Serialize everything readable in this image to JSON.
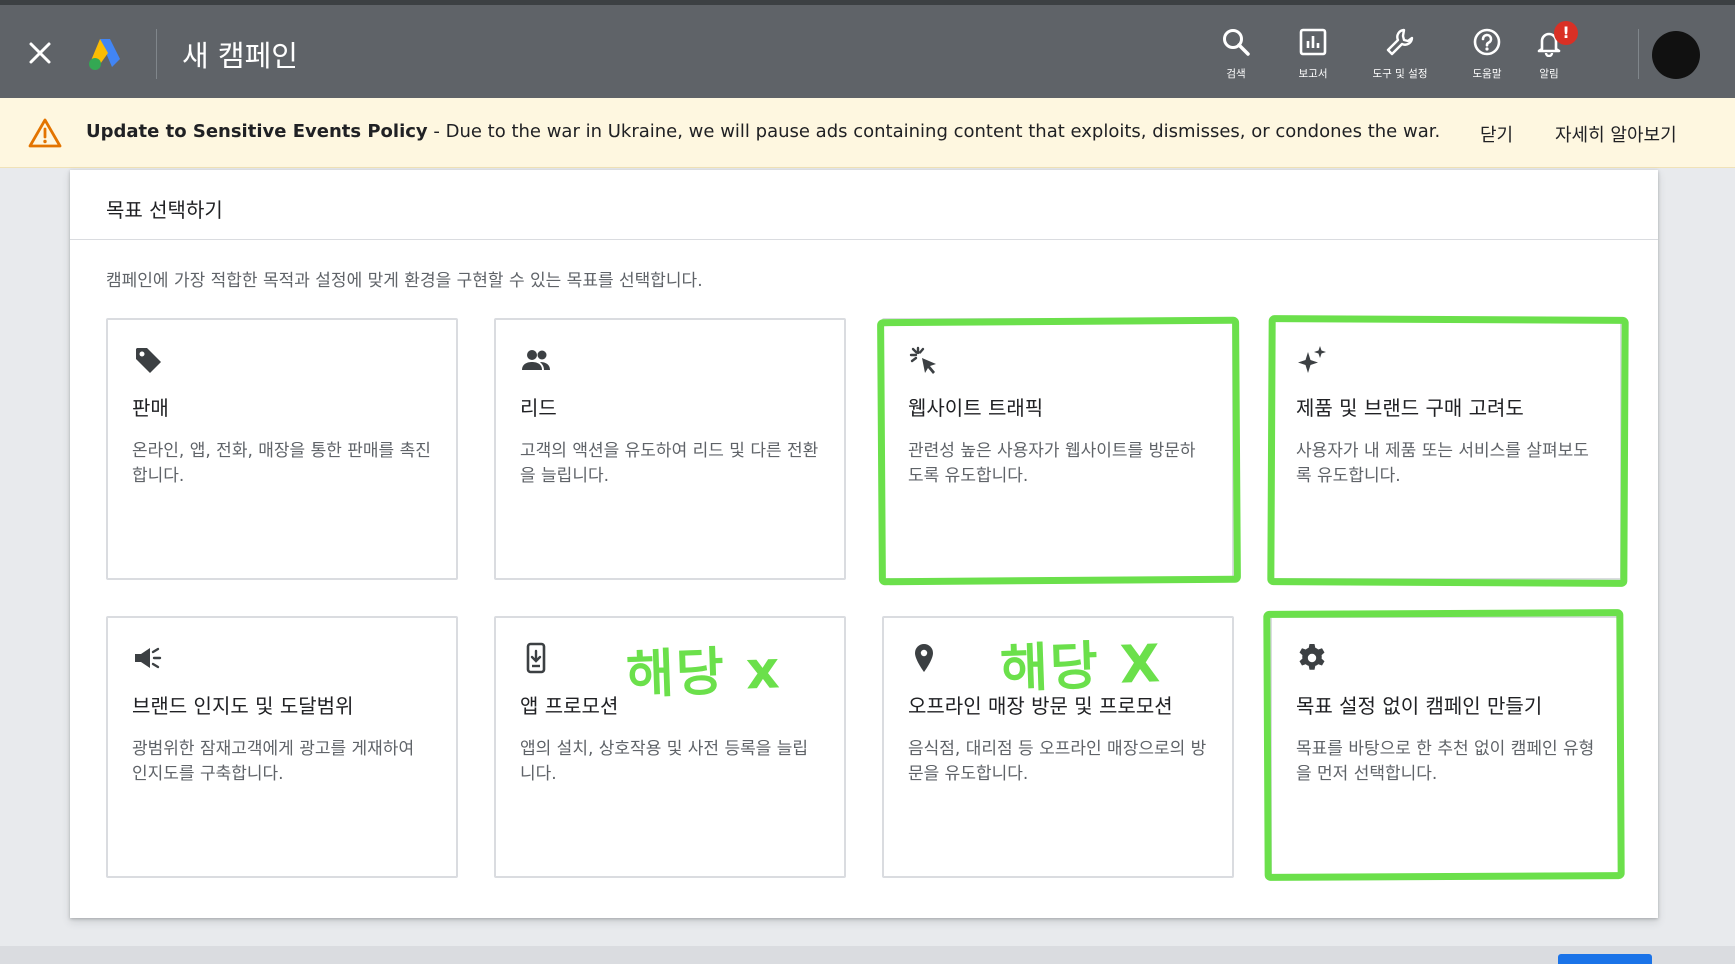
{
  "topbar": {
    "title": "새 캠페인",
    "tools": [
      {
        "label": "검색",
        "icon": "search-icon"
      },
      {
        "label": "보고서",
        "icon": "reports-icon"
      },
      {
        "label": "도구 및 설정",
        "icon": "tools-icon"
      },
      {
        "label": "도움말",
        "icon": "help-icon"
      },
      {
        "label": "알림",
        "icon": "notifications-icon",
        "badge": "!"
      }
    ]
  },
  "banner": {
    "title": "Update to Sensitive Events Policy",
    "separator": " - ",
    "message": "Due to the war in Ukraine, we will pause ads containing content that exploits, dismisses, or condones the war.",
    "dismiss_label": "닫기",
    "learn_more_label": "자세히 알아보기"
  },
  "panel": {
    "header": "목표 선택하기",
    "description": "캠페인에 가장 적합한 목적과 설정에 맞게 환경을 구현할 수 있는 목표를 선택합니다.",
    "goals": [
      {
        "title": "판매",
        "desc": "온라인, 앱, 전화, 매장을 통한 판매를 촉진합니다.",
        "icon": "tag-icon"
      },
      {
        "title": "리드",
        "desc": "고객의 액션을 유도하여 리드 및 다른 전환을 늘립니다.",
        "icon": "people-icon"
      },
      {
        "title": "웹사이트 트래픽",
        "desc": "관련성 높은 사용자가 웹사이트를 방문하도록 유도합니다.",
        "icon": "cursor-click-icon"
      },
      {
        "title": "제품 및 브랜드 구매 고려도",
        "desc": "사용자가 내 제품 또는 서비스를 살펴보도록 유도합니다.",
        "icon": "sparkle-icon"
      },
      {
        "title": "브랜드 인지도 및 도달범위",
        "desc": "광범위한 잠재고객에게 광고를 게재하여 인지도를 구축합니다.",
        "icon": "megaphone-icon"
      },
      {
        "title": "앱 프로모션",
        "desc": "앱의 설치, 상호작용 및 사전 등록을 늘립니다.",
        "icon": "phone-download-icon"
      },
      {
        "title": "오프라인 매장 방문 및 프로모션",
        "desc": "음식점, 대리점 등 오프라인 매장으로의 방문을 유도합니다.",
        "icon": "location-pin-icon"
      },
      {
        "title": "목표 설정 없이 캠페인 만들기",
        "desc": "목표를 바탕으로 한 추천 없이 캠페인 유형을 먼저 선택합니다.",
        "icon": "gear-icon"
      }
    ]
  },
  "annotations": {
    "not_applicable_1": "해당 x",
    "not_applicable_2": "해당 X",
    "color": "#6be04b"
  },
  "colors": {
    "topbar": "#5f6368",
    "banner_bg": "#fef7e0",
    "warning": "#e37400",
    "primary_button": "#1a73e8"
  }
}
